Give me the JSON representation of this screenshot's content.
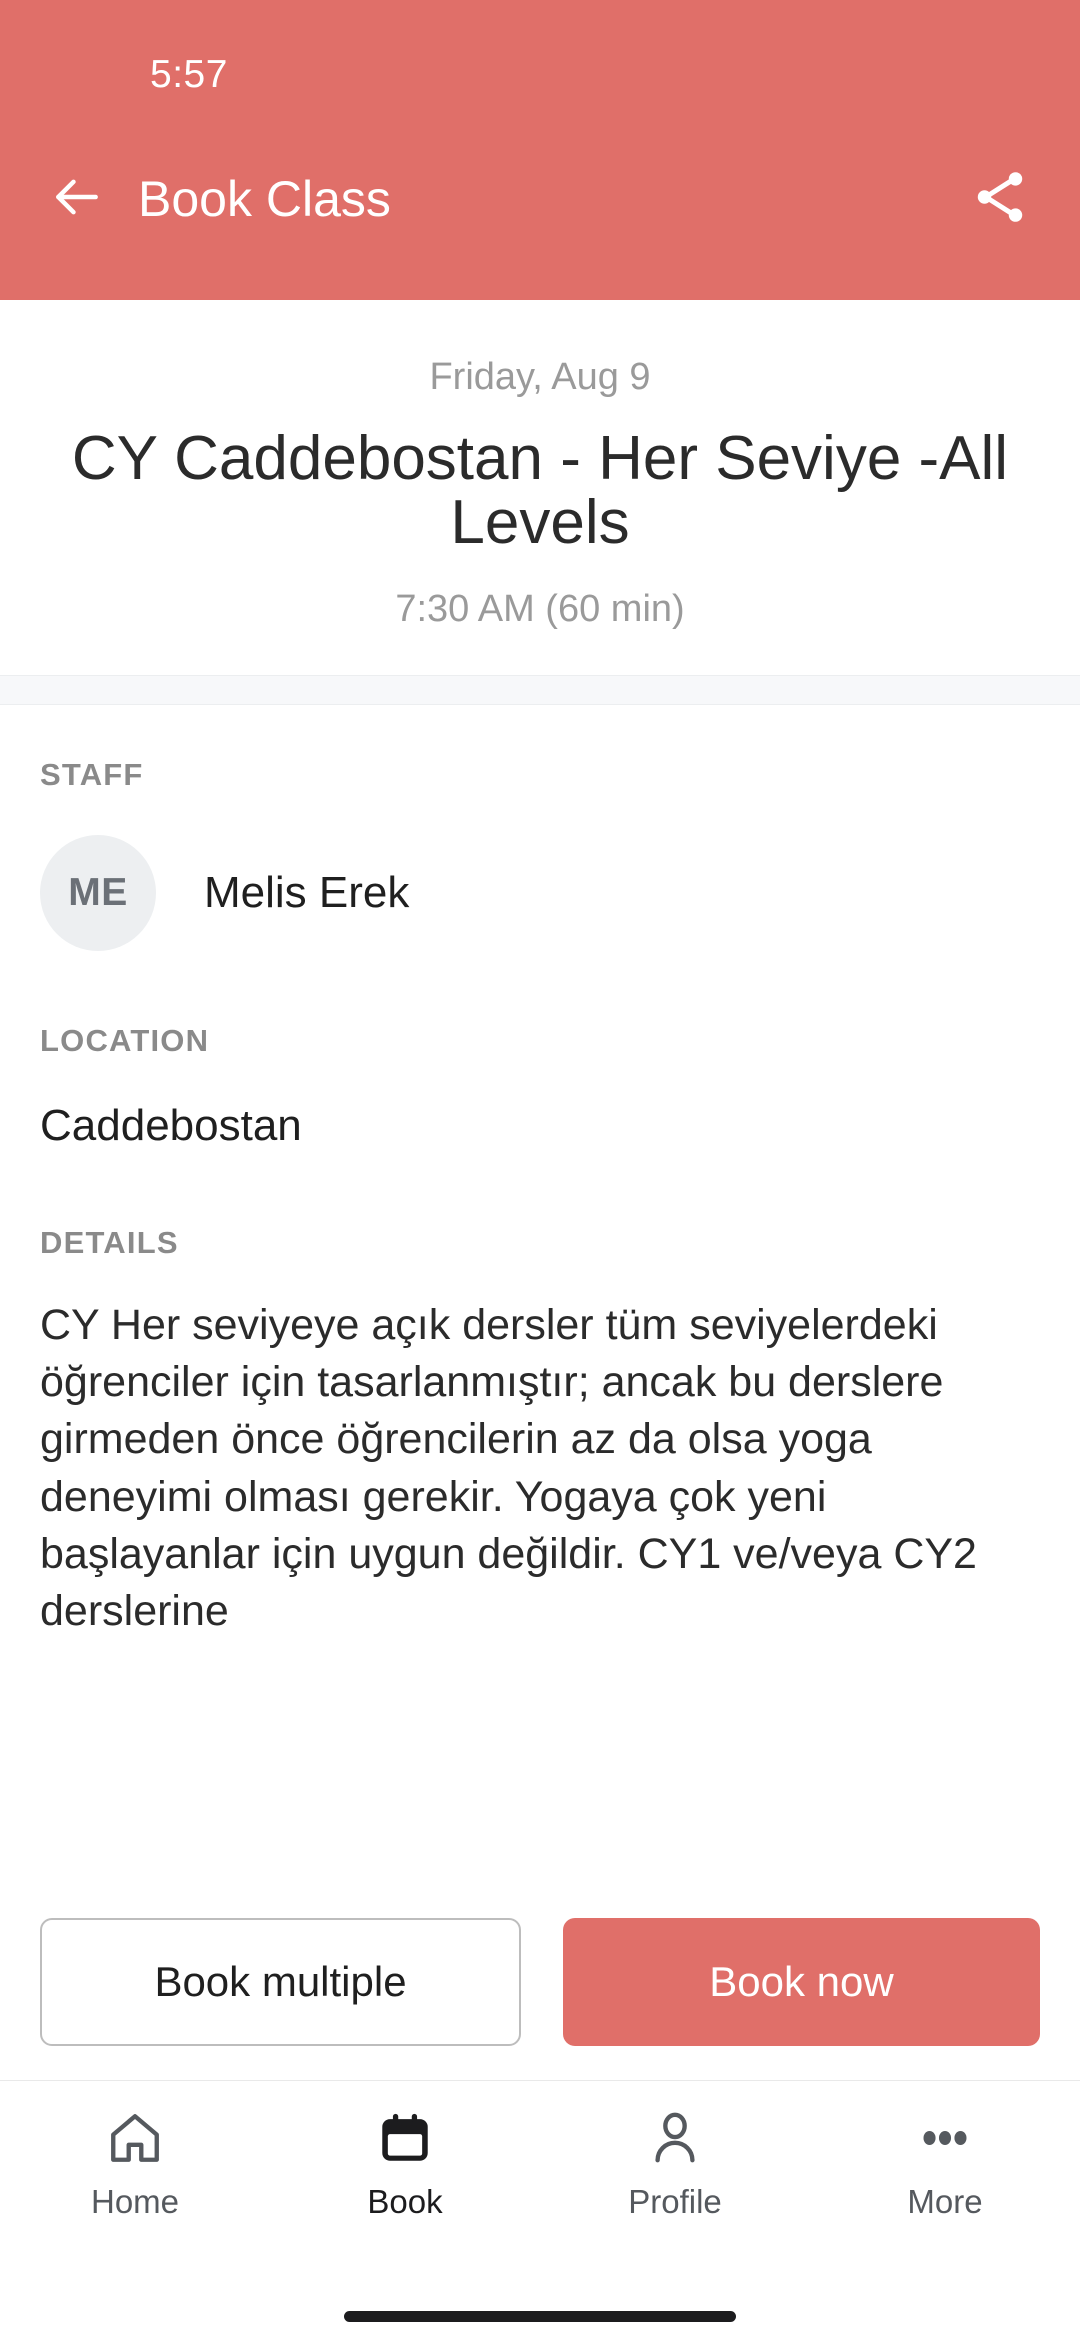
{
  "status_bar": {
    "time": "5:57"
  },
  "app_bar": {
    "title": "Book Class",
    "back_icon": "arrow-left-icon",
    "share_icon": "share-icon",
    "background_color": "#e06f69"
  },
  "class_header": {
    "date": "Friday, Aug 9",
    "title": "CY Caddebostan - Her Seviye -All Levels",
    "time": "7:30 AM (60 min)"
  },
  "staff": {
    "label": "STAFF",
    "avatar_initials": "ME",
    "name": "Melis Erek"
  },
  "location": {
    "label": "LOCATION",
    "value": "Caddebostan"
  },
  "details": {
    "label": "DETAILS",
    "text": "CY Her seviyeye açık dersler tüm seviyelerdeki öğrenciler için tasarlanmıştır; ancak bu derslere girmeden önce öğrencilerin az da olsa yoga deneyimi olması gerekir. Yogaya çok yeni başlayanlar için uygun değildir. CY1 ve/veya CY2 derslerine"
  },
  "actions": {
    "secondary_label": "Book multiple",
    "primary_label": "Book now",
    "primary_color": "#e06f69"
  },
  "bottom_nav": {
    "items": [
      {
        "label": "Home",
        "icon": "home-icon",
        "active": false
      },
      {
        "label": "Book",
        "icon": "calendar-icon",
        "active": true
      },
      {
        "label": "Profile",
        "icon": "person-icon",
        "active": false
      },
      {
        "label": "More",
        "icon": "ellipsis-icon",
        "active": false
      }
    ]
  }
}
